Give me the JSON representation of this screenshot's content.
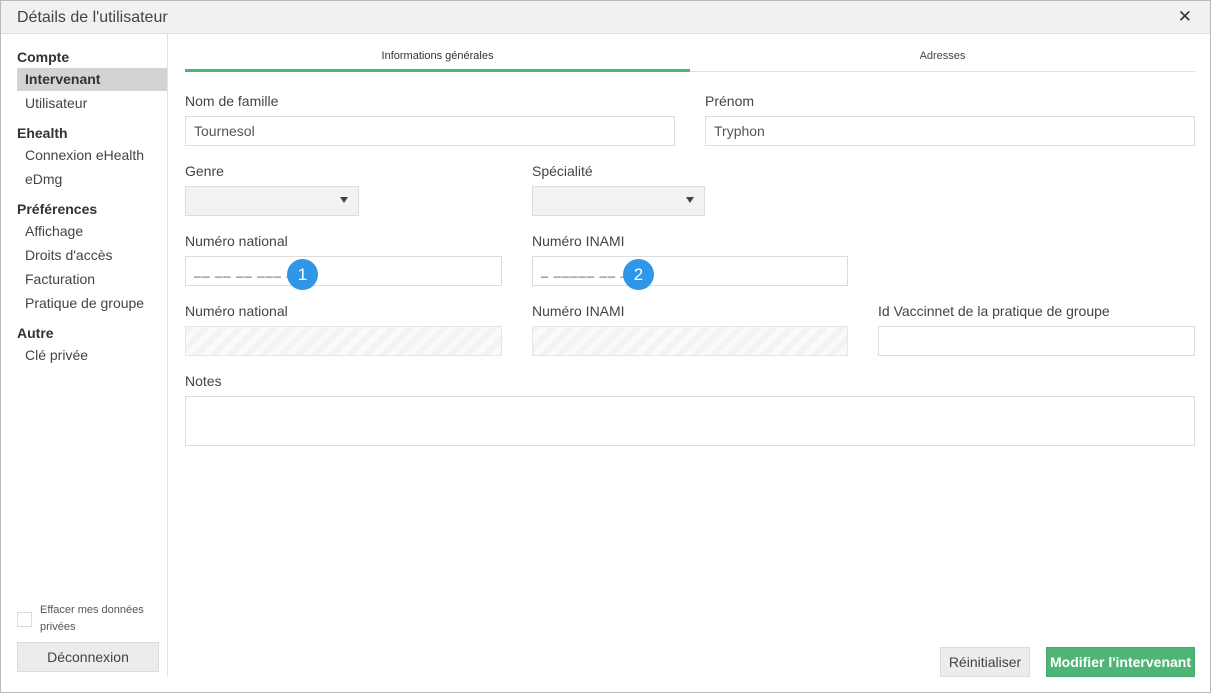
{
  "window": {
    "title": "Détails de l'utilisateur"
  },
  "sidebar": {
    "sections": [
      {
        "title": "Compte",
        "items": [
          "Intervenant",
          "Utilisateur"
        ]
      },
      {
        "title": "Ehealth",
        "items": [
          "Connexion eHealth",
          "eDmg"
        ]
      },
      {
        "title": "Préférences",
        "items": [
          "Affichage",
          "Droits d'accès",
          "Facturation",
          "Pratique de groupe"
        ]
      },
      {
        "title": "Autre",
        "items": [
          "Clé privée"
        ]
      }
    ],
    "active_item": "Intervenant",
    "wipe_data_label": "Effacer mes données privées",
    "logout_label": "Déconnexion"
  },
  "tabs": [
    {
      "label": "Informations générales",
      "active": true
    },
    {
      "label": "Adresses",
      "active": false
    }
  ],
  "form": {
    "last_name": {
      "label": "Nom de famille",
      "value": "Tournesol"
    },
    "first_name": {
      "label": "Prénom",
      "value": "Tryphon"
    },
    "gender": {
      "label": "Genre",
      "value": ""
    },
    "specialty": {
      "label": "Spécialité",
      "value": ""
    },
    "national_number": {
      "label": "Numéro national",
      "value": "__ __ __ ___ __"
    },
    "inami_number": {
      "label": "Numéro INAMI",
      "value": "_ _____ __ ___"
    },
    "national_number_ro": {
      "label": "Numéro national",
      "value": ""
    },
    "inami_number_ro": {
      "label": "Numéro INAMI",
      "value": ""
    },
    "vaccinnet_id": {
      "label": "Id Vaccinnet de la pratique de groupe",
      "value": ""
    },
    "notes": {
      "label": "Notes",
      "value": ""
    }
  },
  "annotations": [
    "1",
    "2"
  ],
  "actions": {
    "reset_label": "Réinitialiser",
    "submit_label": "Modifier l'intervenant"
  },
  "colors": {
    "accent": "#4fb577",
    "badge": "#2f96e8",
    "active_sidebar_bg": "#d3d3d3"
  }
}
